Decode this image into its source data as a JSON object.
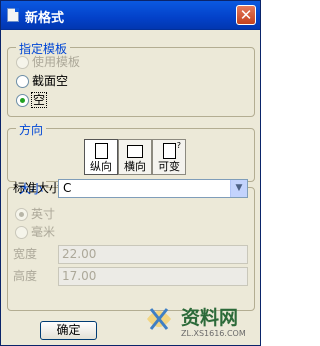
{
  "window": {
    "title": "新格式",
    "close_glyph": "✕"
  },
  "template_group": {
    "legend": "指定模板",
    "options": [
      {
        "label": "使用模板",
        "checked": false,
        "disabled": true
      },
      {
        "label": "截面空",
        "checked": false,
        "disabled": false
      },
      {
        "label": "空",
        "checked": true,
        "disabled": false
      }
    ]
  },
  "direction_group": {
    "legend": "方向",
    "buttons": [
      {
        "label": "纵向",
        "icon": "portrait-page-icon",
        "active": true
      },
      {
        "label": "横向",
        "icon": "landscape-page-icon",
        "active": false
      },
      {
        "label": "可变",
        "icon": "variable-page-icon",
        "active": false
      }
    ],
    "variable_mark": "?"
  },
  "size_group": {
    "legend": "大小",
    "standard_size_label": "标准大小",
    "standard_size_value": "C",
    "units": [
      {
        "label": "英寸",
        "checked": true,
        "disabled": true
      },
      {
        "label": "毫米",
        "checked": false,
        "disabled": true
      }
    ],
    "width_label": "宽度",
    "width_value": "22.00",
    "height_label": "高度",
    "height_value": "17.00"
  },
  "ok_button": "确定",
  "watermark": {
    "text": "资料网",
    "url": "ZL.XS1616.COM"
  },
  "colors": {
    "titlebar": "#0341c9",
    "legend": "#0046d5",
    "dialog_bg": "#ece9d8"
  }
}
